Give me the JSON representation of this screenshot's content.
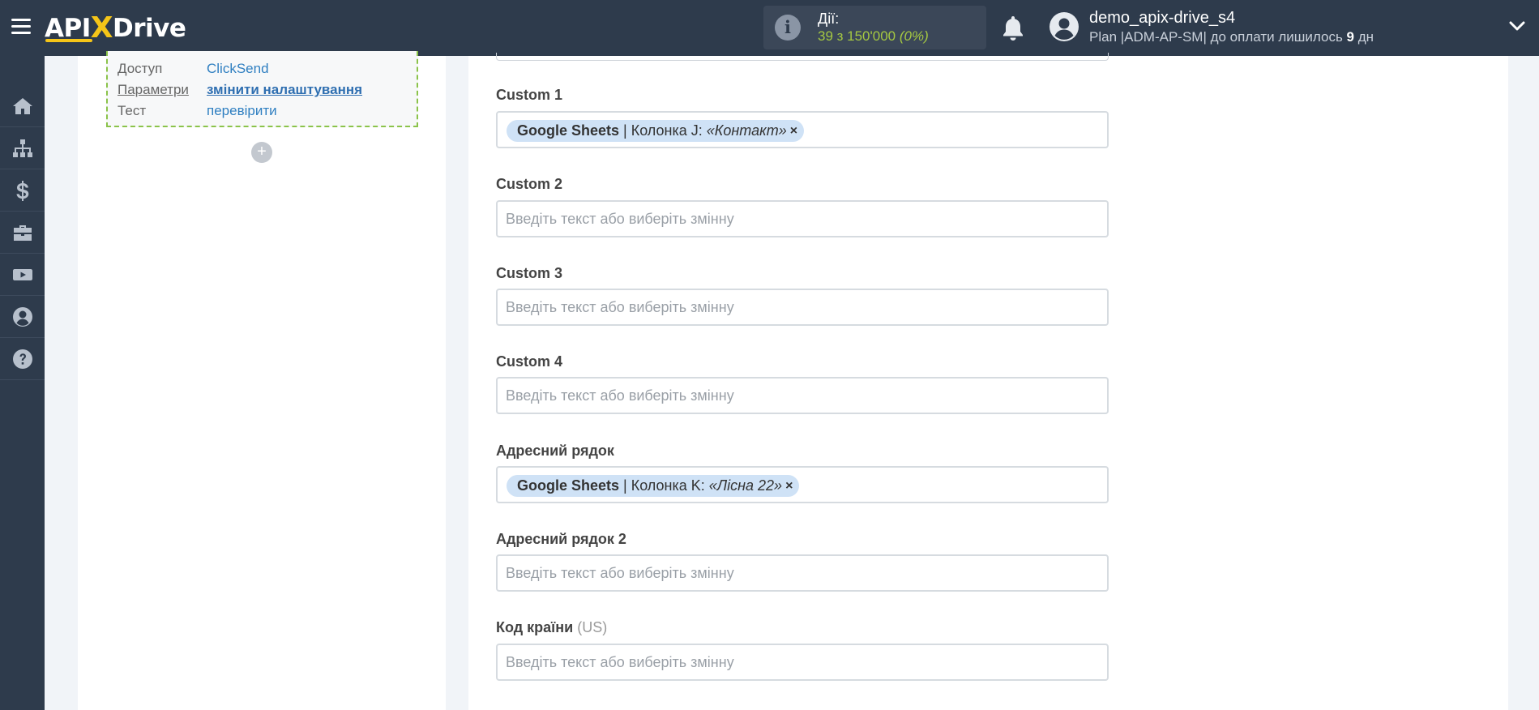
{
  "header": {
    "logo": {
      "api": "API",
      "x": "X",
      "drive": "Drive"
    },
    "actions": {
      "title": "Дії:",
      "value": "39 з 150'000",
      "percent": "(0%)"
    },
    "user": {
      "name": "demo_apix-drive_s4",
      "plan_prefix": "Plan |ADM-AP-SM| до оплати лишилось ",
      "plan_days": "9",
      "plan_suffix": " дн"
    }
  },
  "sidenav": {
    "items": [
      "home-icon",
      "sitemap-icon",
      "dollar-icon",
      "briefcase-icon",
      "youtube-icon",
      "user-icon",
      "help-icon"
    ]
  },
  "connection": {
    "rows": [
      {
        "label": "Доступ",
        "value": "ClickSend"
      },
      {
        "label": "Параметри",
        "value": "змінити налаштування"
      },
      {
        "label": "Тест",
        "value": "перевірити"
      }
    ],
    "add_label": "+"
  },
  "form": {
    "placeholder": "Введіть текст або виберіть змінну",
    "fields": [
      {
        "label": "Custom 1",
        "tag": {
          "source": "Google Sheets",
          "column": " | Колонка J: ",
          "value": "«Контакт»",
          "remove": "×"
        }
      },
      {
        "label": "Custom 2"
      },
      {
        "label": "Custom 3"
      },
      {
        "label": "Custom 4"
      },
      {
        "label": "Адресний рядок",
        "tag": {
          "source": "Google Sheets",
          "column": " | Колонка K: ",
          "value": "«Лісна 22»",
          "remove": "×"
        }
      },
      {
        "label": "Адресний рядок 2"
      },
      {
        "label": "Код країни",
        "hint": "(US)"
      }
    ]
  },
  "colors": {
    "topbar": "#2e3b4c",
    "accent_yellow": "#f5c518",
    "actions_green": "#a5c842",
    "link_blue": "#2f7fc1",
    "tag_bg": "#cfe2f6",
    "dashed_green": "#8bc34a"
  }
}
